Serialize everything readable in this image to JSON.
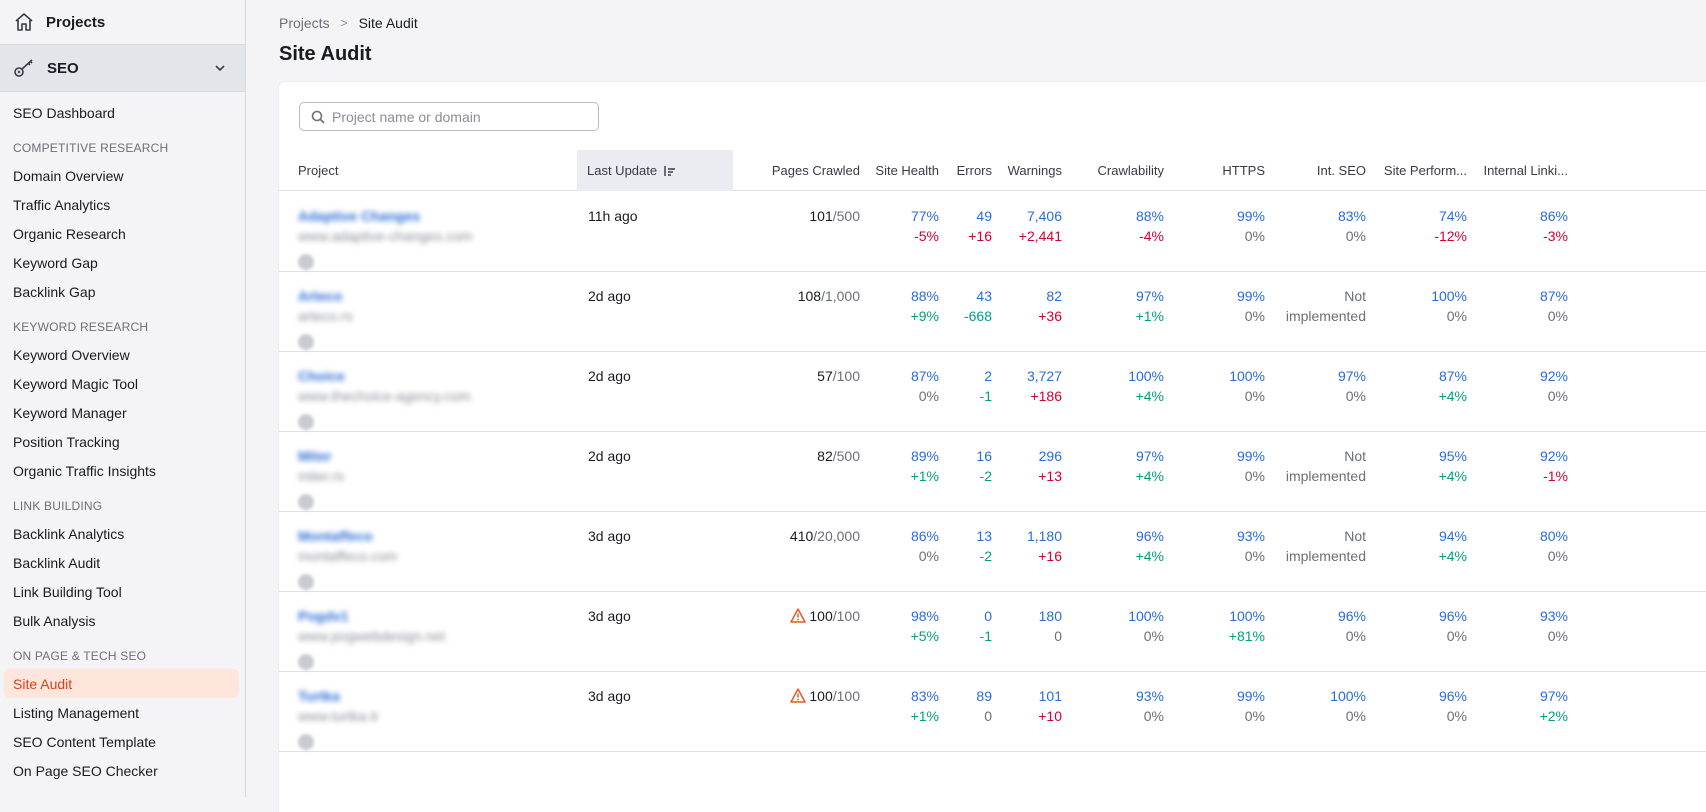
{
  "sidebar": {
    "projects_label": "Projects",
    "seo_label": "SEO",
    "items": [
      {
        "type": "item",
        "label": "SEO Dashboard"
      },
      {
        "type": "section",
        "label": "COMPETITIVE RESEARCH"
      },
      {
        "type": "item",
        "label": "Domain Overview"
      },
      {
        "type": "item",
        "label": "Traffic Analytics"
      },
      {
        "type": "item",
        "label": "Organic Research"
      },
      {
        "type": "item",
        "label": "Keyword Gap"
      },
      {
        "type": "item",
        "label": "Backlink Gap"
      },
      {
        "type": "section",
        "label": "KEYWORD RESEARCH"
      },
      {
        "type": "item",
        "label": "Keyword Overview"
      },
      {
        "type": "item",
        "label": "Keyword Magic Tool"
      },
      {
        "type": "item",
        "label": "Keyword Manager"
      },
      {
        "type": "item",
        "label": "Position Tracking"
      },
      {
        "type": "item",
        "label": "Organic Traffic Insights"
      },
      {
        "type": "section",
        "label": "LINK BUILDING"
      },
      {
        "type": "item",
        "label": "Backlink Analytics"
      },
      {
        "type": "item",
        "label": "Backlink Audit"
      },
      {
        "type": "item",
        "label": "Link Building Tool"
      },
      {
        "type": "item",
        "label": "Bulk Analysis"
      },
      {
        "type": "section",
        "label": "ON PAGE & TECH SEO"
      },
      {
        "type": "item",
        "label": "Site Audit",
        "active": true
      },
      {
        "type": "item",
        "label": "Listing Management"
      },
      {
        "type": "item",
        "label": "SEO Content Template"
      },
      {
        "type": "item",
        "label": "On Page SEO Checker"
      }
    ]
  },
  "breadcrumb": {
    "root": "Projects",
    "current": "Site Audit"
  },
  "page_title": "Site Audit",
  "search": {
    "placeholder": "Project name or domain",
    "value": ""
  },
  "columns": {
    "project": "Project",
    "last_update": "Last Update",
    "pages_crawled": "Pages Crawled",
    "site_health": "Site Health",
    "errors": "Errors",
    "warnings": "Warnings",
    "crawlability": "Crawlability",
    "https": "HTTPS",
    "int_seo": "Int. SEO",
    "site_performance": "Site Perform...",
    "internal_linking": "Internal Linki..."
  },
  "colors": {
    "accent": "#d5421b",
    "link": "#2b6cd4",
    "negative": "#d1002f",
    "positive": "#009f81"
  },
  "rows": [
    {
      "name": "Adaptive Changes",
      "domain": "www.adaptive-changes.com",
      "updated": "11h ago",
      "warn": false,
      "crawled": "101",
      "limit": "/500",
      "health": [
        "77%",
        "-5%",
        "red"
      ],
      "errors": [
        "49",
        "+16",
        "red"
      ],
      "warnings": [
        "7,406",
        "+2,441",
        "red"
      ],
      "crawl": [
        "88%",
        "-4%",
        "red"
      ],
      "https": [
        "99%",
        "0%",
        "gray"
      ],
      "intseo": [
        "83%",
        "0%",
        "gray"
      ],
      "perf": [
        "74%",
        "-12%",
        "red"
      ],
      "link": [
        "86%",
        "-3%",
        "red"
      ]
    },
    {
      "name": "Arteco",
      "domain": "arteco.rs",
      "updated": "2d ago",
      "warn": false,
      "crawled": "108",
      "limit": "/1,000",
      "health": [
        "88%",
        "+9%",
        "green"
      ],
      "errors": [
        "43",
        "-668",
        "green"
      ],
      "warnings": [
        "82",
        "+36",
        "red"
      ],
      "crawl": [
        "97%",
        "+1%",
        "green"
      ],
      "https": [
        "99%",
        "0%",
        "gray"
      ],
      "intseo": [
        "Not",
        "implemented",
        "plain"
      ],
      "perf": [
        "100%",
        "0%",
        "gray"
      ],
      "link": [
        "87%",
        "0%",
        "gray"
      ]
    },
    {
      "name": "Choice",
      "domain": "www.thechoice-agency.com",
      "updated": "2d ago",
      "warn": false,
      "crawled": "57",
      "limit": "/100",
      "health": [
        "87%",
        "0%",
        "gray"
      ],
      "errors": [
        "2",
        "-1",
        "green"
      ],
      "warnings": [
        "3,727",
        "+186",
        "red"
      ],
      "crawl": [
        "100%",
        "+4%",
        "green"
      ],
      "https": [
        "100%",
        "0%",
        "gray"
      ],
      "intseo": [
        "97%",
        "0%",
        "gray"
      ],
      "perf": [
        "87%",
        "+4%",
        "green"
      ],
      "link": [
        "92%",
        "0%",
        "gray"
      ]
    },
    {
      "name": "Miter",
      "domain": "miter.rs",
      "updated": "2d ago",
      "warn": false,
      "crawled": "82",
      "limit": "/500",
      "health": [
        "89%",
        "+1%",
        "green"
      ],
      "errors": [
        "16",
        "-2",
        "green"
      ],
      "warnings": [
        "296",
        "+13",
        "red"
      ],
      "crawl": [
        "97%",
        "+4%",
        "green"
      ],
      "https": [
        "99%",
        "0%",
        "gray"
      ],
      "intseo": [
        "Not",
        "implemented",
        "plain"
      ],
      "perf": [
        "95%",
        "+4%",
        "green"
      ],
      "link": [
        "92%",
        "-1%",
        "red"
      ]
    },
    {
      "name": "Montaffeco",
      "domain": "montaffeco.com",
      "updated": "3d ago",
      "warn": false,
      "crawled": "410",
      "limit": "/20,000",
      "health": [
        "86%",
        "0%",
        "gray"
      ],
      "errors": [
        "13",
        "-2",
        "green"
      ],
      "warnings": [
        "1,180",
        "+16",
        "red"
      ],
      "crawl": [
        "96%",
        "+4%",
        "green"
      ],
      "https": [
        "93%",
        "0%",
        "gray"
      ],
      "intseo": [
        "Not",
        "implemented",
        "plain"
      ],
      "perf": [
        "94%",
        "+4%",
        "green"
      ],
      "link": [
        "80%",
        "0%",
        "gray"
      ]
    },
    {
      "name": "Pogdv1",
      "domain": "www.pogwebdesign.net",
      "updated": "3d ago",
      "warn": true,
      "crawled": "100",
      "limit": "/100",
      "health": [
        "98%",
        "+5%",
        "green"
      ],
      "errors": [
        "0",
        "-1",
        "green"
      ],
      "warnings": [
        "180",
        "0",
        "gray"
      ],
      "crawl": [
        "100%",
        "0%",
        "gray"
      ],
      "https": [
        "100%",
        "+81%",
        "green"
      ],
      "intseo": [
        "96%",
        "0%",
        "gray"
      ],
      "perf": [
        "96%",
        "0%",
        "gray"
      ],
      "link": [
        "93%",
        "0%",
        "gray"
      ]
    },
    {
      "name": "Turtka",
      "domain": "www.turtka.tr",
      "updated": "3d ago",
      "warn": true,
      "crawled": "100",
      "limit": "/100",
      "health": [
        "83%",
        "+1%",
        "green"
      ],
      "errors": [
        "89",
        "0",
        "gray"
      ],
      "warnings": [
        "101",
        "+10",
        "red"
      ],
      "crawl": [
        "93%",
        "0%",
        "gray"
      ],
      "https": [
        "99%",
        "0%",
        "gray"
      ],
      "intseo": [
        "100%",
        "0%",
        "gray"
      ],
      "perf": [
        "96%",
        "0%",
        "gray"
      ],
      "link": [
        "97%",
        "+2%",
        "green"
      ]
    }
  ]
}
